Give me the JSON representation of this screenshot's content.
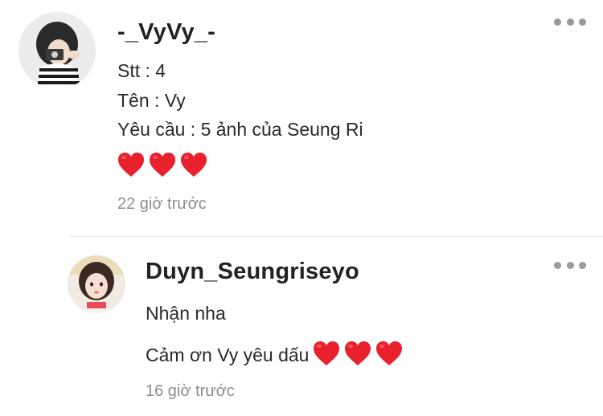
{
  "comments": [
    {
      "username": "-_VyVy_-",
      "lines": [
        "Stt : 4",
        "Tên : Vy",
        "Yêu cầu : 5 ảnh của Seung Ri"
      ],
      "hearts": 3,
      "time": "22 giờ trước"
    },
    {
      "username": "Duyn_Seungriseyo",
      "lines": [
        "Nhận nha",
        "Cảm ơn Vy yêu dấu"
      ],
      "hearts": 3,
      "time": "16 giờ trước"
    }
  ],
  "colors": {
    "heart": "#e8212d",
    "meta_text": "#8e8e8e",
    "divider": "#e6e6e6"
  },
  "icons": {
    "more": "more-options-icon",
    "heart": "red-heart-emoji"
  }
}
